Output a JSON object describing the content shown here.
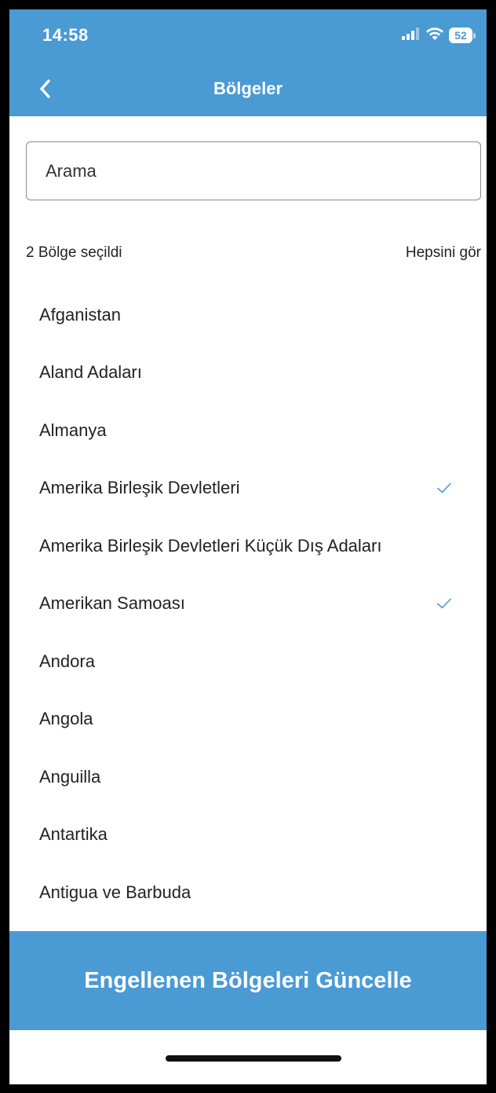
{
  "status_bar": {
    "time": "14:58",
    "battery": "52",
    "icons": [
      "signal-icon",
      "wifi-icon",
      "battery-icon"
    ]
  },
  "header": {
    "title": "Bölgeler",
    "back_icon": "chevron-left-icon"
  },
  "search": {
    "placeholder": "Arama",
    "value": ""
  },
  "selection": {
    "summary": "2 Bölge seçildi",
    "see_all_label": "Hepsini gör"
  },
  "regions": [
    {
      "name": "Afganistan",
      "selected": false
    },
    {
      "name": "Aland Adaları",
      "selected": false
    },
    {
      "name": "Almanya",
      "selected": false
    },
    {
      "name": "Amerika Birleşik Devletleri",
      "selected": true
    },
    {
      "name": "Amerika Birleşik Devletleri Küçük Dış Adaları",
      "selected": false
    },
    {
      "name": "Amerikan Samoası",
      "selected": true
    },
    {
      "name": "Andora",
      "selected": false
    },
    {
      "name": "Angola",
      "selected": false
    },
    {
      "name": "Anguilla",
      "selected": false
    },
    {
      "name": "Antartika",
      "selected": false
    },
    {
      "name": "Antigua ve Barbuda",
      "selected": false
    }
  ],
  "footer": {
    "update_button_label": "Engellenen Bölgeleri Güncelle"
  },
  "colors": {
    "accent": "#4a9ad4",
    "check": "#4a9ad4",
    "text": "#222222",
    "background": "#ffffff"
  }
}
